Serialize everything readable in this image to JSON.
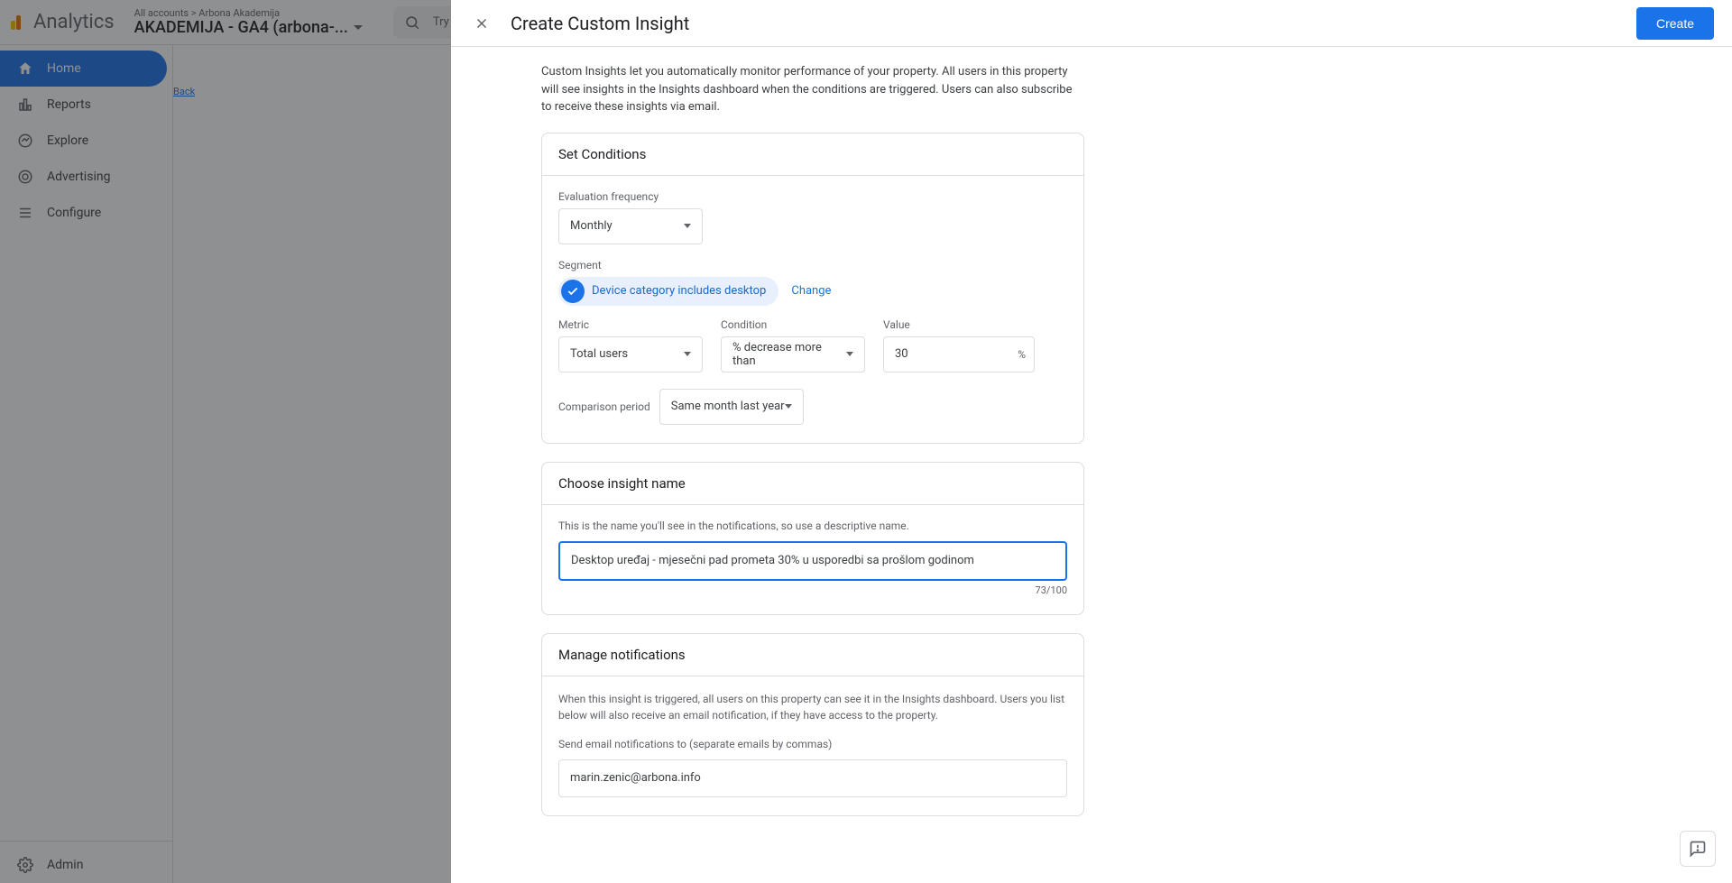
{
  "app": {
    "brand": "Analytics",
    "breadcrumb_top": "All accounts > Arbona Akademija",
    "breadcrumb_main": "AKADEMIJA - GA4 (arbona-...",
    "search_placeholder": "Try searching...",
    "back_link": "Back"
  },
  "nav": {
    "items": [
      {
        "label": "Home",
        "active": true
      },
      {
        "label": "Reports",
        "active": false
      },
      {
        "label": "Explore",
        "active": false
      },
      {
        "label": "Advertising",
        "active": false
      },
      {
        "label": "Configure",
        "active": false
      }
    ],
    "admin_label": "Admin"
  },
  "modal": {
    "title": "Create Custom Insight",
    "create_button": "Create",
    "intro": "Custom Insights let you automatically monitor performance of your property. All users in this property will see insights in the Insights dashboard when the conditions are triggered. Users can also subscribe to receive these insights via email."
  },
  "conditions": {
    "card_title": "Set Conditions",
    "eval_label": "Evaluation frequency",
    "eval_value": "Monthly",
    "segment_label": "Segment",
    "segment_chip": "Device category includes desktop",
    "segment_change": "Change",
    "metric_label": "Metric",
    "metric_value": "Total users",
    "condition_label": "Condition",
    "condition_value": "% decrease more than",
    "value_label": "Value",
    "value_value": "30",
    "value_suffix": "%",
    "comparison_label": "Comparison period",
    "comparison_value": "Same month last year"
  },
  "name": {
    "card_title": "Choose insight name",
    "hint": "This is the name you'll see in the notifications, so use a descriptive name.",
    "value": "Desktop uređaj - mjesečni pad prometa 30% u usporedbi sa prošlom godinom",
    "char_count": "73/100"
  },
  "notifications": {
    "card_title": "Manage notifications",
    "description": "When this insight is triggered, all users on this property can see it in the Insights dashboard. Users you list below will also receive an email notification, if they have access to the property.",
    "email_label": "Send email notifications to (separate emails by commas)",
    "email_value": "marin.zenic@arbona.info"
  }
}
